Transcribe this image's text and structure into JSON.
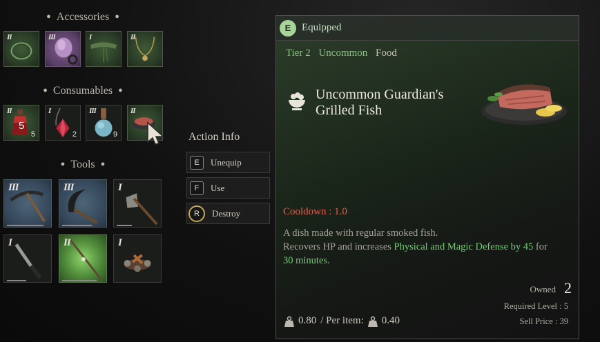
{
  "inventory": {
    "accessories_title": "Accessories",
    "consumables_title": "Consumables",
    "tools_title": "Tools",
    "accessories": [
      {
        "tier": "II",
        "icon": "ring-icon"
      },
      {
        "tier": "III",
        "icon": "purple-ring-icon"
      },
      {
        "tier": "I",
        "icon": "green-cloth-icon"
      },
      {
        "tier": "II",
        "icon": "necklace-icon"
      }
    ],
    "consumables": [
      {
        "tier": "II",
        "count": "5",
        "stack": "5",
        "icon": "red-potion-icon"
      },
      {
        "tier": "I",
        "count": "2",
        "icon": "red-crystal-icon"
      },
      {
        "tier": "III",
        "count": "9",
        "icon": "blue-potion-icon"
      },
      {
        "tier": "II",
        "icon": "grilled-fish-icon"
      }
    ],
    "tools": [
      {
        "tier": "III",
        "icon": "pickaxe-icon",
        "durability": 0.85
      },
      {
        "tier": "III",
        "icon": "sickle-icon",
        "durability": 0.7
      },
      {
        "tier": "I",
        "icon": "axe-icon",
        "durability": 0.35
      },
      {
        "tier": "I",
        "icon": "knife-icon",
        "durability": 0.45
      },
      {
        "tier": "II",
        "icon": "fishing-rod-icon",
        "durability": 0.8
      },
      {
        "tier": "I",
        "icon": "campfire-icon",
        "durability": 0
      }
    ]
  },
  "action_info": {
    "title": "Action Info",
    "actions": [
      {
        "key": "E",
        "label": "Unequip"
      },
      {
        "key": "F",
        "label": "Use"
      },
      {
        "key": "R",
        "label": "Destroy"
      }
    ]
  },
  "detail": {
    "badge": "E",
    "status": "Equipped",
    "tier": "Tier 2",
    "rarity": "Uncommon",
    "type": "Food",
    "name": "Uncommon Guardian's Grilled Fish",
    "cooldown": "Cooldown : 1.0",
    "desc_line1": "A dish made with regular smoked fish.",
    "desc_line2_pre": "Recovers HP and increases ",
    "desc_highlight1": "Physical and Magic Defense by 45",
    "desc_line2_post": " for",
    "desc_highlight2": "30 minutes",
    "desc_end": ".",
    "owned_label": "Owned",
    "owned_value": "2",
    "required_level": "Required Level : 5",
    "sell_price": "Sell Price : 39",
    "weight": "0.80",
    "per_item_label": "/ Per item:",
    "per_item_weight": "0.40"
  },
  "colors": {
    "rarity_green": "#8dbf86",
    "cooldown_red": "#e05f52",
    "highlight_green": "#6fcf6f"
  }
}
